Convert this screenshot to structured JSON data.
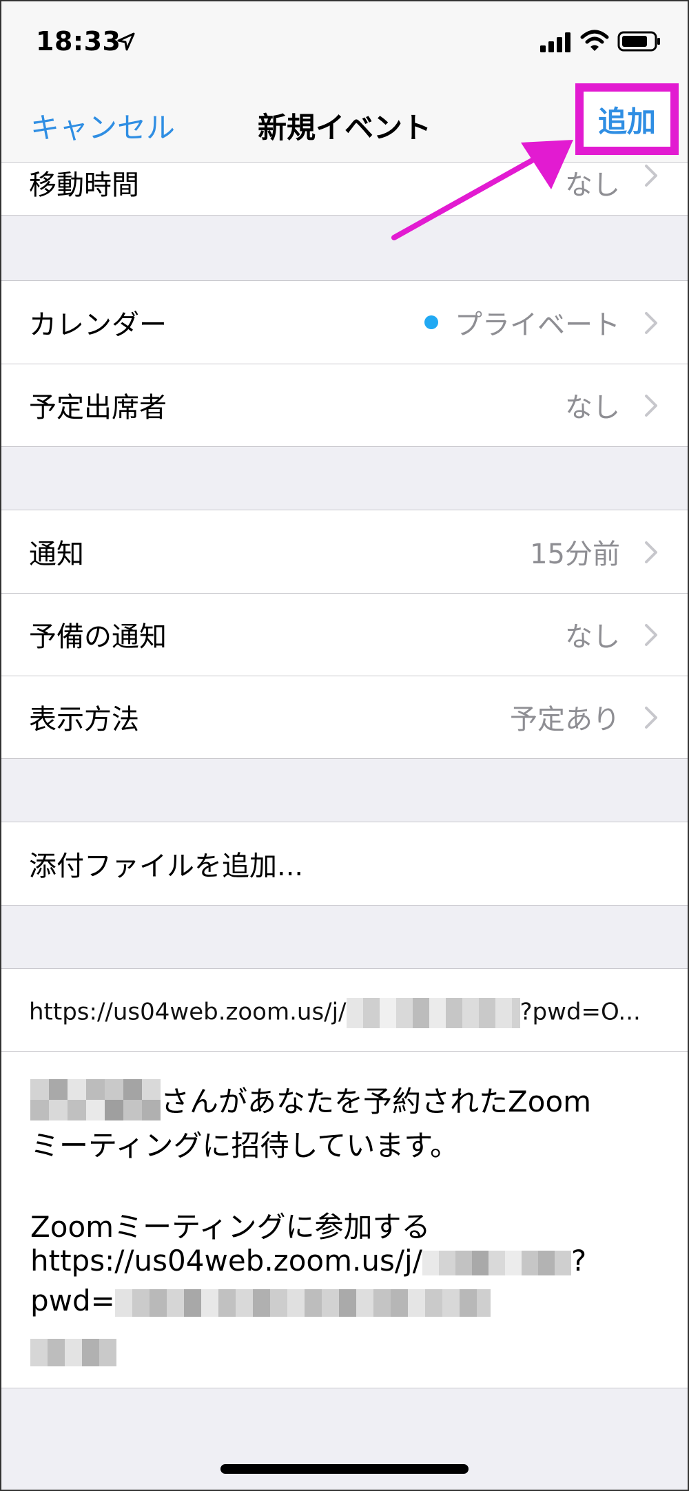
{
  "status_bar": {
    "time": "18:33"
  },
  "nav": {
    "cancel_label": "キャンセル",
    "title": "新規イベント",
    "add_label": "追加"
  },
  "rows": {
    "travel_time": {
      "label": "移動時間",
      "value": "なし"
    },
    "calendar": {
      "label": "カレンダー",
      "value": "プライベート"
    },
    "invitees": {
      "label": "予定出席者",
      "value": "なし"
    },
    "alert": {
      "label": "通知",
      "value": "15分前"
    },
    "second_alert": {
      "label": "予備の通知",
      "value": "なし"
    },
    "show_as": {
      "label": "表示方法",
      "value": "予定あり"
    },
    "attachment": {
      "label": "添付ファイルを追加..."
    }
  },
  "url": {
    "prefix": "https://us04web.zoom.us/j/",
    "suffix": "?pwd=O..."
  },
  "notes": {
    "line1_suffix": "さんがあなたを予約されたZoom",
    "line2": "ミーティングに招待しています。",
    "line3": "Zoomミーティングに参加する",
    "line4_prefix": "https://us04web.zoom.us/j/",
    "line4_suffix": "?",
    "line5_prefix": "pwd="
  },
  "colors": {
    "accent_blue": "#2f8ee3",
    "highlight_magenta": "#e21bd1",
    "calendar_dot": "#21a9f3"
  }
}
